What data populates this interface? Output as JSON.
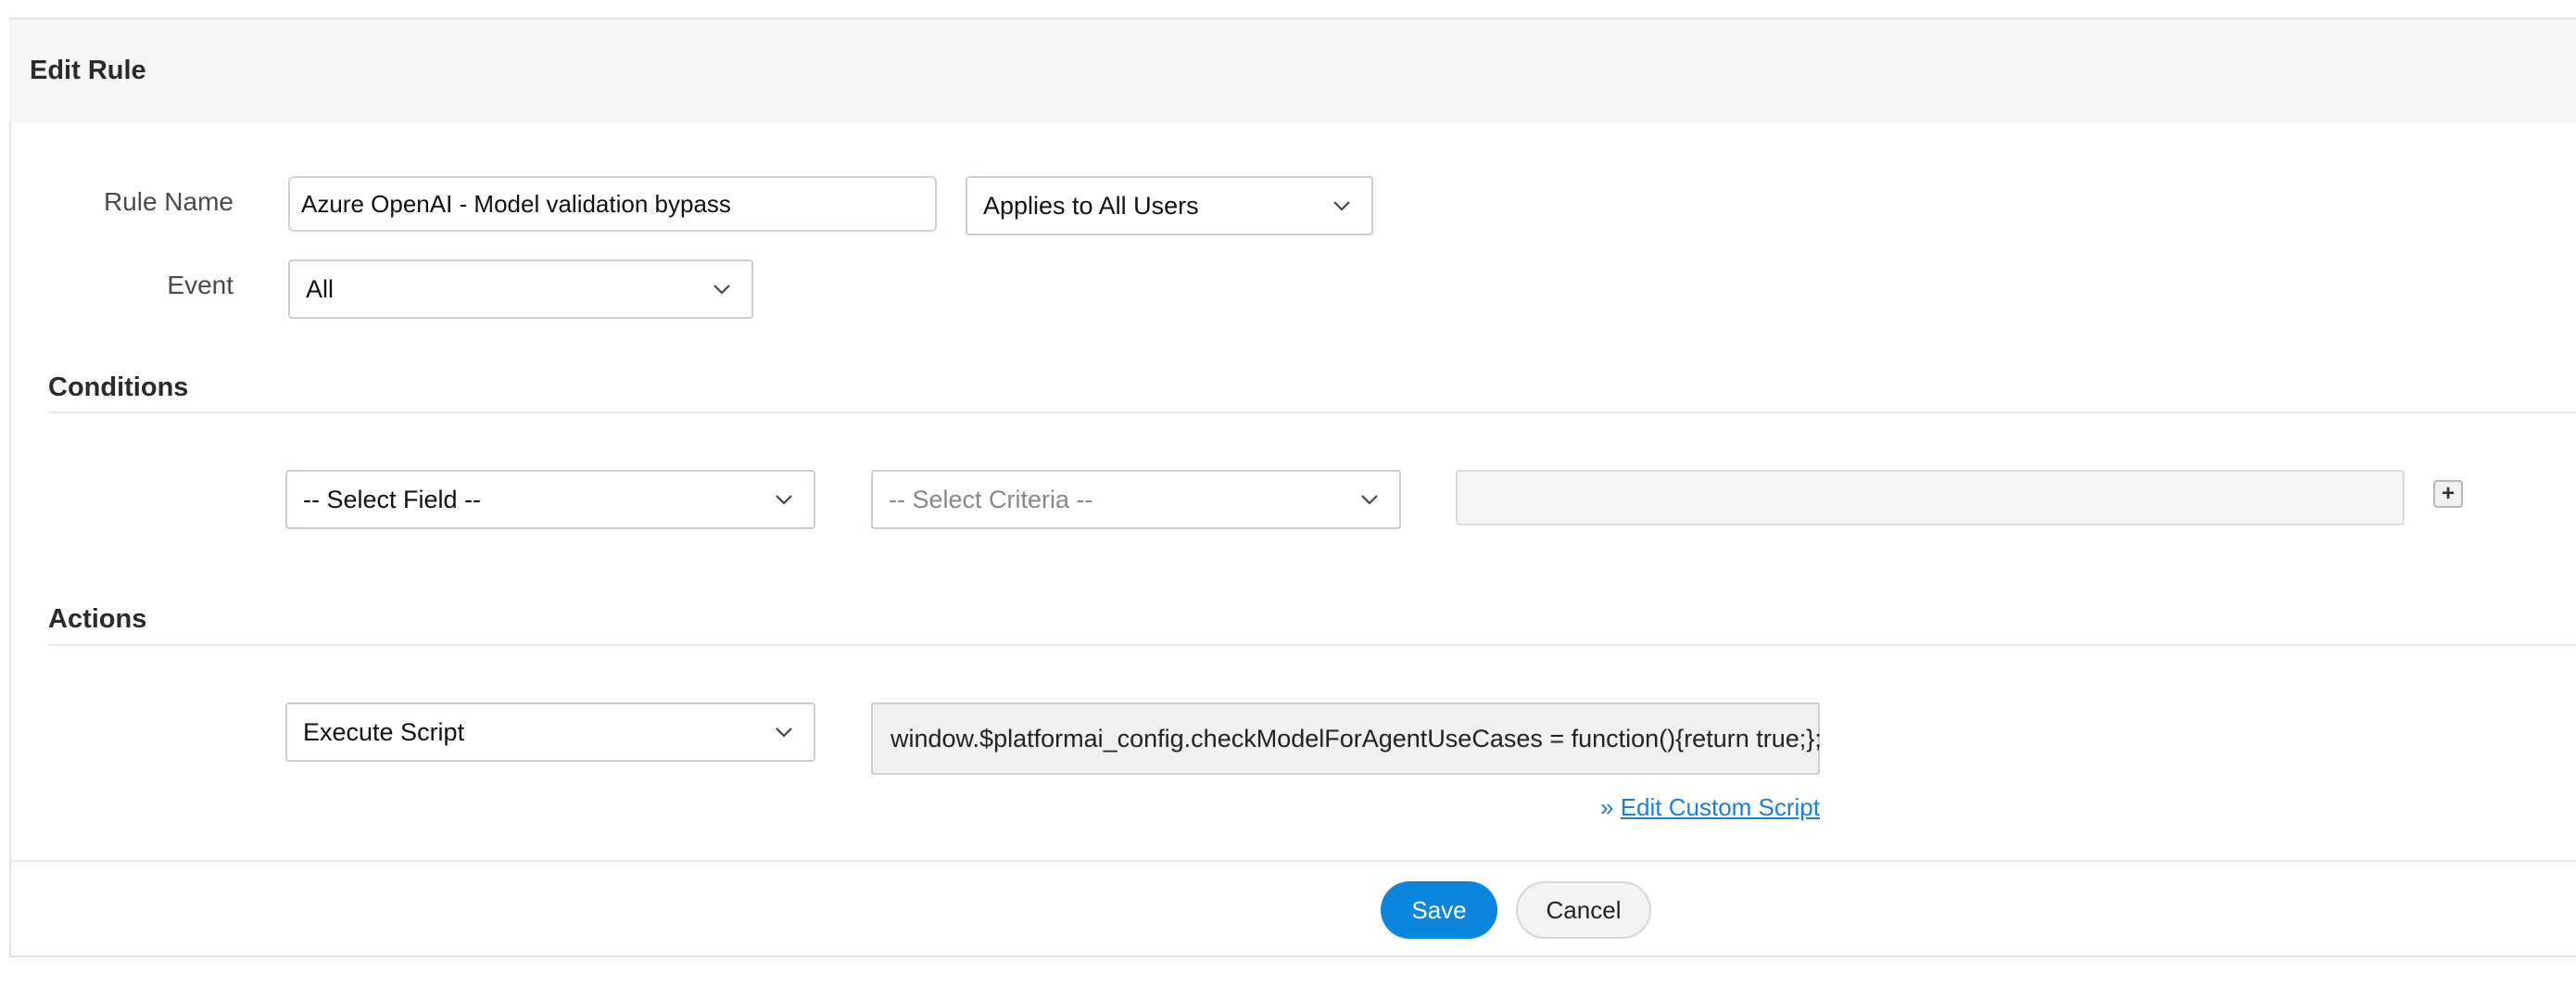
{
  "panel": {
    "title": "Edit Rule"
  },
  "form": {
    "rule_name_label": "Rule Name",
    "rule_name_value": "Azure OpenAI - Model validation bypass",
    "applies_to_value": "Applies to All Users",
    "event_label": "Event",
    "event_value": "All"
  },
  "conditions": {
    "title": "Conditions",
    "field_select": "-- Select Field --",
    "criteria_select": "-- Select Criteria --",
    "value": "",
    "add_label": "+"
  },
  "actions": {
    "title": "Actions",
    "action_select": "Execute Script",
    "script_text": "window.$platformai_config.checkModelForAgentUseCases = function(){return true;};",
    "edit_link_prefix": "» ",
    "edit_link_label": "Edit Custom Script"
  },
  "footer": {
    "save_label": "Save",
    "cancel_label": "Cancel"
  },
  "colors": {
    "primary": "#0a86de",
    "link": "#1a7fd6",
    "header_bg": "#f5f5f5"
  },
  "icons": {
    "dropdown": "chevron-down-icon",
    "add": "plus-icon"
  }
}
